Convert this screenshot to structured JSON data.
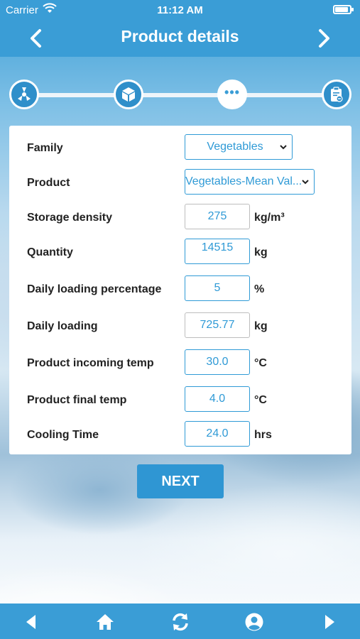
{
  "status_bar": {
    "carrier": "Carrier",
    "time": "11:12 AM"
  },
  "nav": {
    "title": "Product details",
    "back_icon": "chevron-left-icon",
    "forward_icon": "chevron-right-icon"
  },
  "stepper": {
    "steps": [
      {
        "icon": "fan-icon",
        "state": "done"
      },
      {
        "icon": "box-icon",
        "state": "done"
      },
      {
        "icon": "more-icon",
        "label": "•••",
        "state": "current"
      },
      {
        "icon": "clipboard-icon",
        "state": "pending"
      }
    ]
  },
  "form": {
    "family": {
      "label": "Family",
      "value": "Vegetables"
    },
    "product": {
      "label": "Product",
      "value": "Vegetables-Mean Val..."
    },
    "storage_density": {
      "label": "Storage density",
      "value": "275",
      "unit": "kg/m³"
    },
    "quantity": {
      "label": "Quantity",
      "value": "14515",
      "unit": "kg"
    },
    "daily_loading_percentage": {
      "label": "Daily loading percentage",
      "value": "5",
      "unit": "%"
    },
    "daily_loading": {
      "label": "Daily loading",
      "value": "725.77",
      "unit": "kg"
    },
    "incoming_temp": {
      "label": "Product incoming temp",
      "value": "30.0",
      "unit": "°C"
    },
    "final_temp": {
      "label": "Product final temp",
      "value": "4.0",
      "unit": "°C"
    },
    "cooling_time": {
      "label": "Cooling Time",
      "value": "24.0",
      "unit": "hrs"
    }
  },
  "next_button": {
    "label": "NEXT"
  },
  "bottom_bar": {
    "icons": [
      "triangle-left-icon",
      "home-icon",
      "refresh-icon",
      "user-icon",
      "triangle-right-icon"
    ]
  },
  "colors": {
    "primary": "#3a9dd6",
    "accent": "#2f9ad6",
    "card": "#ffffff"
  }
}
